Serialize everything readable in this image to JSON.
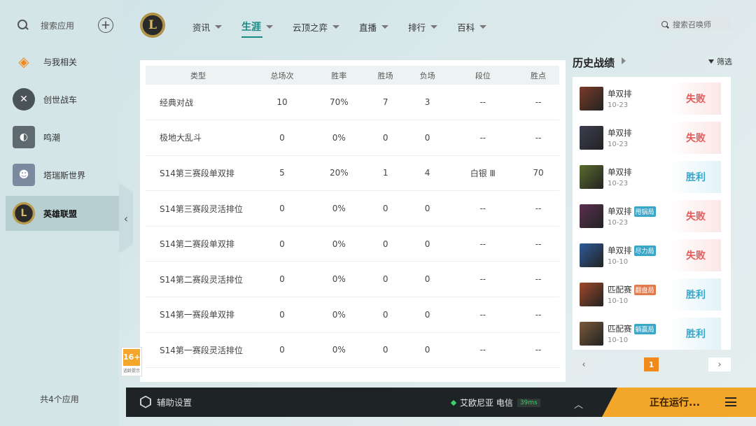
{
  "sidebar": {
    "search_label": "搜索应用",
    "items": [
      {
        "label": "与我相关",
        "icon": "target-icon"
      },
      {
        "label": "创世战车",
        "icon": "crossout-icon"
      },
      {
        "label": "鸣潮",
        "icon": "wuthering-icon"
      },
      {
        "label": "塔瑞斯世界",
        "icon": "tarisland-icon"
      },
      {
        "label": "英雄联盟",
        "icon": "lol-icon",
        "active": true
      }
    ],
    "footer": "共4个应用"
  },
  "header": {
    "logo_letter": "L",
    "nav": [
      {
        "label": "资讯"
      },
      {
        "label": "生涯",
        "active": true
      },
      {
        "label": "云顶之弈"
      },
      {
        "label": "直播"
      },
      {
        "label": "排行"
      },
      {
        "label": "百科"
      }
    ],
    "search_placeholder": "搜索召唤师"
  },
  "stats": {
    "columns": [
      "类型",
      "总场次",
      "胜率",
      "胜场",
      "负场",
      "段位",
      "胜点"
    ],
    "rows": [
      [
        "经典对战",
        "10",
        "70%",
        "7",
        "3",
        "--",
        "--"
      ],
      [
        "极地大乱斗",
        "0",
        "0%",
        "0",
        "0",
        "--",
        "--"
      ],
      [
        "S14第三赛段单双排",
        "5",
        "20%",
        "1",
        "4",
        "白银 Ⅲ",
        "70"
      ],
      [
        "S14第三赛段灵活排位",
        "0",
        "0%",
        "0",
        "0",
        "--",
        "--"
      ],
      [
        "S14第二赛段单双排",
        "0",
        "0%",
        "0",
        "0",
        "--",
        "--"
      ],
      [
        "S14第二赛段灵活排位",
        "0",
        "0%",
        "0",
        "0",
        "--",
        "--"
      ],
      [
        "S14第一赛段单双排",
        "0",
        "0%",
        "0",
        "0",
        "--",
        "--"
      ],
      [
        "S14第一赛段灵活排位",
        "0",
        "0%",
        "0",
        "0",
        "--",
        "--"
      ]
    ]
  },
  "history": {
    "title": "历史战绩",
    "filter_label": "筛选",
    "matches": [
      {
        "mode": "单双排",
        "tag": "",
        "date": "10-23",
        "result": "失败",
        "win": false,
        "color": "#7a3b28"
      },
      {
        "mode": "单双排",
        "tag": "",
        "date": "10-23",
        "result": "失败",
        "win": false,
        "color": "#3d3d52"
      },
      {
        "mode": "单双排",
        "tag": "",
        "date": "10-23",
        "result": "胜利",
        "win": true,
        "color": "#5c6b2e"
      },
      {
        "mode": "单双排",
        "tag": "甩锅局",
        "tag_color": "blue",
        "date": "10-23",
        "result": "失败",
        "win": false,
        "color": "#5a3050"
      },
      {
        "mode": "单双排",
        "tag": "尽力局",
        "tag_color": "blue",
        "date": "10-10",
        "result": "失败",
        "win": false,
        "color": "#2e5a9a"
      },
      {
        "mode": "匹配赛",
        "tag": "翻盘局",
        "tag_color": "orange",
        "date": "10-10",
        "result": "胜利",
        "win": true,
        "color": "#a04a2a"
      },
      {
        "mode": "匹配赛",
        "tag": "躺赢局",
        "tag_color": "blue",
        "date": "10-10",
        "result": "胜利",
        "win": true,
        "color": "#7a5a3a"
      }
    ],
    "page": "1",
    "prev": "‹",
    "next": "›"
  },
  "age_badge": {
    "rating": "16+",
    "note": "适龄提示"
  },
  "bottom": {
    "assist_label": "辅助设置",
    "server": "艾欧尼亚 电信",
    "ping": "39ms",
    "status": "正在运行..."
  }
}
